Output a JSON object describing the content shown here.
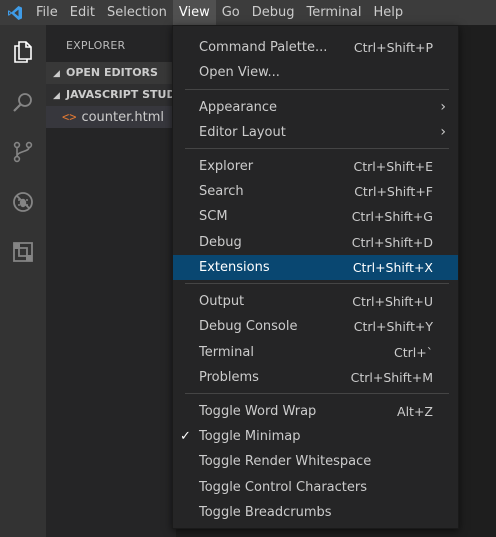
{
  "menubar": {
    "items": [
      "File",
      "Edit",
      "Selection",
      "View",
      "Go",
      "Debug",
      "Terminal",
      "Help"
    ]
  },
  "activitybar": {
    "icons": [
      "files-icon",
      "search-icon",
      "source-control-icon",
      "debug-icon",
      "extensions-icon"
    ]
  },
  "sidebar": {
    "title": "EXPLORER",
    "open_editors": "OPEN EDITORS",
    "folder": "JAVASCRIPT STUDY",
    "file_icon_glyph": "<>",
    "file": "counter.html"
  },
  "view_menu": {
    "command_palette": "Command Palette...",
    "command_palette_kb": "Ctrl+Shift+P",
    "open_view": "Open View...",
    "appearance": "Appearance",
    "editor_layout": "Editor Layout",
    "explorer": "Explorer",
    "explorer_kb": "Ctrl+Shift+E",
    "search": "Search",
    "search_kb": "Ctrl+Shift+F",
    "scm": "SCM",
    "scm_kb": "Ctrl+Shift+G",
    "debug": "Debug",
    "debug_kb": "Ctrl+Shift+D",
    "extensions": "Extensions",
    "extensions_kb": "Ctrl+Shift+X",
    "output": "Output",
    "output_kb": "Ctrl+Shift+U",
    "debug_console": "Debug Console",
    "debug_console_kb": "Ctrl+Shift+Y",
    "terminal": "Terminal",
    "terminal_kb": "Ctrl+`",
    "problems": "Problems",
    "problems_kb": "Ctrl+Shift+M",
    "toggle_word_wrap": "Toggle Word Wrap",
    "toggle_word_wrap_kb": "Alt+Z",
    "toggle_minimap": "Toggle Minimap",
    "toggle_render_whitespace": "Toggle Render Whitespace",
    "toggle_control_characters": "Toggle Control Characters",
    "toggle_breadcrumbs": "Toggle Breadcrumbs"
  },
  "colors": {
    "accent_highlight": "#094771",
    "menu_bg": "#252526",
    "titlebar_bg": "#3c3c3c",
    "file_icon": "#e37933"
  }
}
